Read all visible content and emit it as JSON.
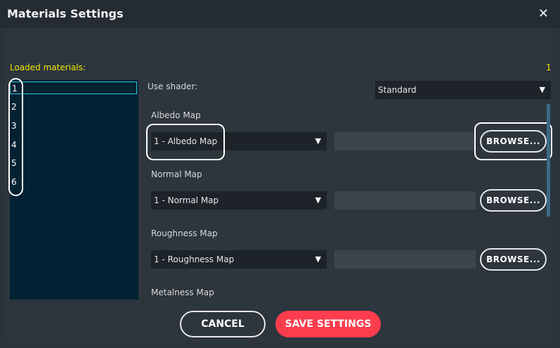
{
  "window": {
    "title": "Materials Settings"
  },
  "materials": {
    "label": "Loaded materials:",
    "count": "1",
    "items": [
      "1",
      "2",
      "3",
      "4",
      "5",
      "6"
    ]
  },
  "shader": {
    "label": "Use shader:",
    "value": "Standard"
  },
  "maps": [
    {
      "label": "Albedo Map",
      "select": "1 - Albedo Map",
      "browse": "BROWSE..."
    },
    {
      "label": "Normal Map",
      "select": "1 - Normal Map",
      "browse": "BROWSE..."
    },
    {
      "label": "Roughness Map",
      "select": "1 - Roughness Map",
      "browse": "BROWSE..."
    },
    {
      "label": "Metalness Map"
    }
  ],
  "footer": {
    "cancel": "CANCEL",
    "save": "SAVE SETTINGS"
  },
  "colors": {
    "accent": "#ff3d4f",
    "highlight": "#f2e600",
    "selection": "#2cc9dd"
  }
}
